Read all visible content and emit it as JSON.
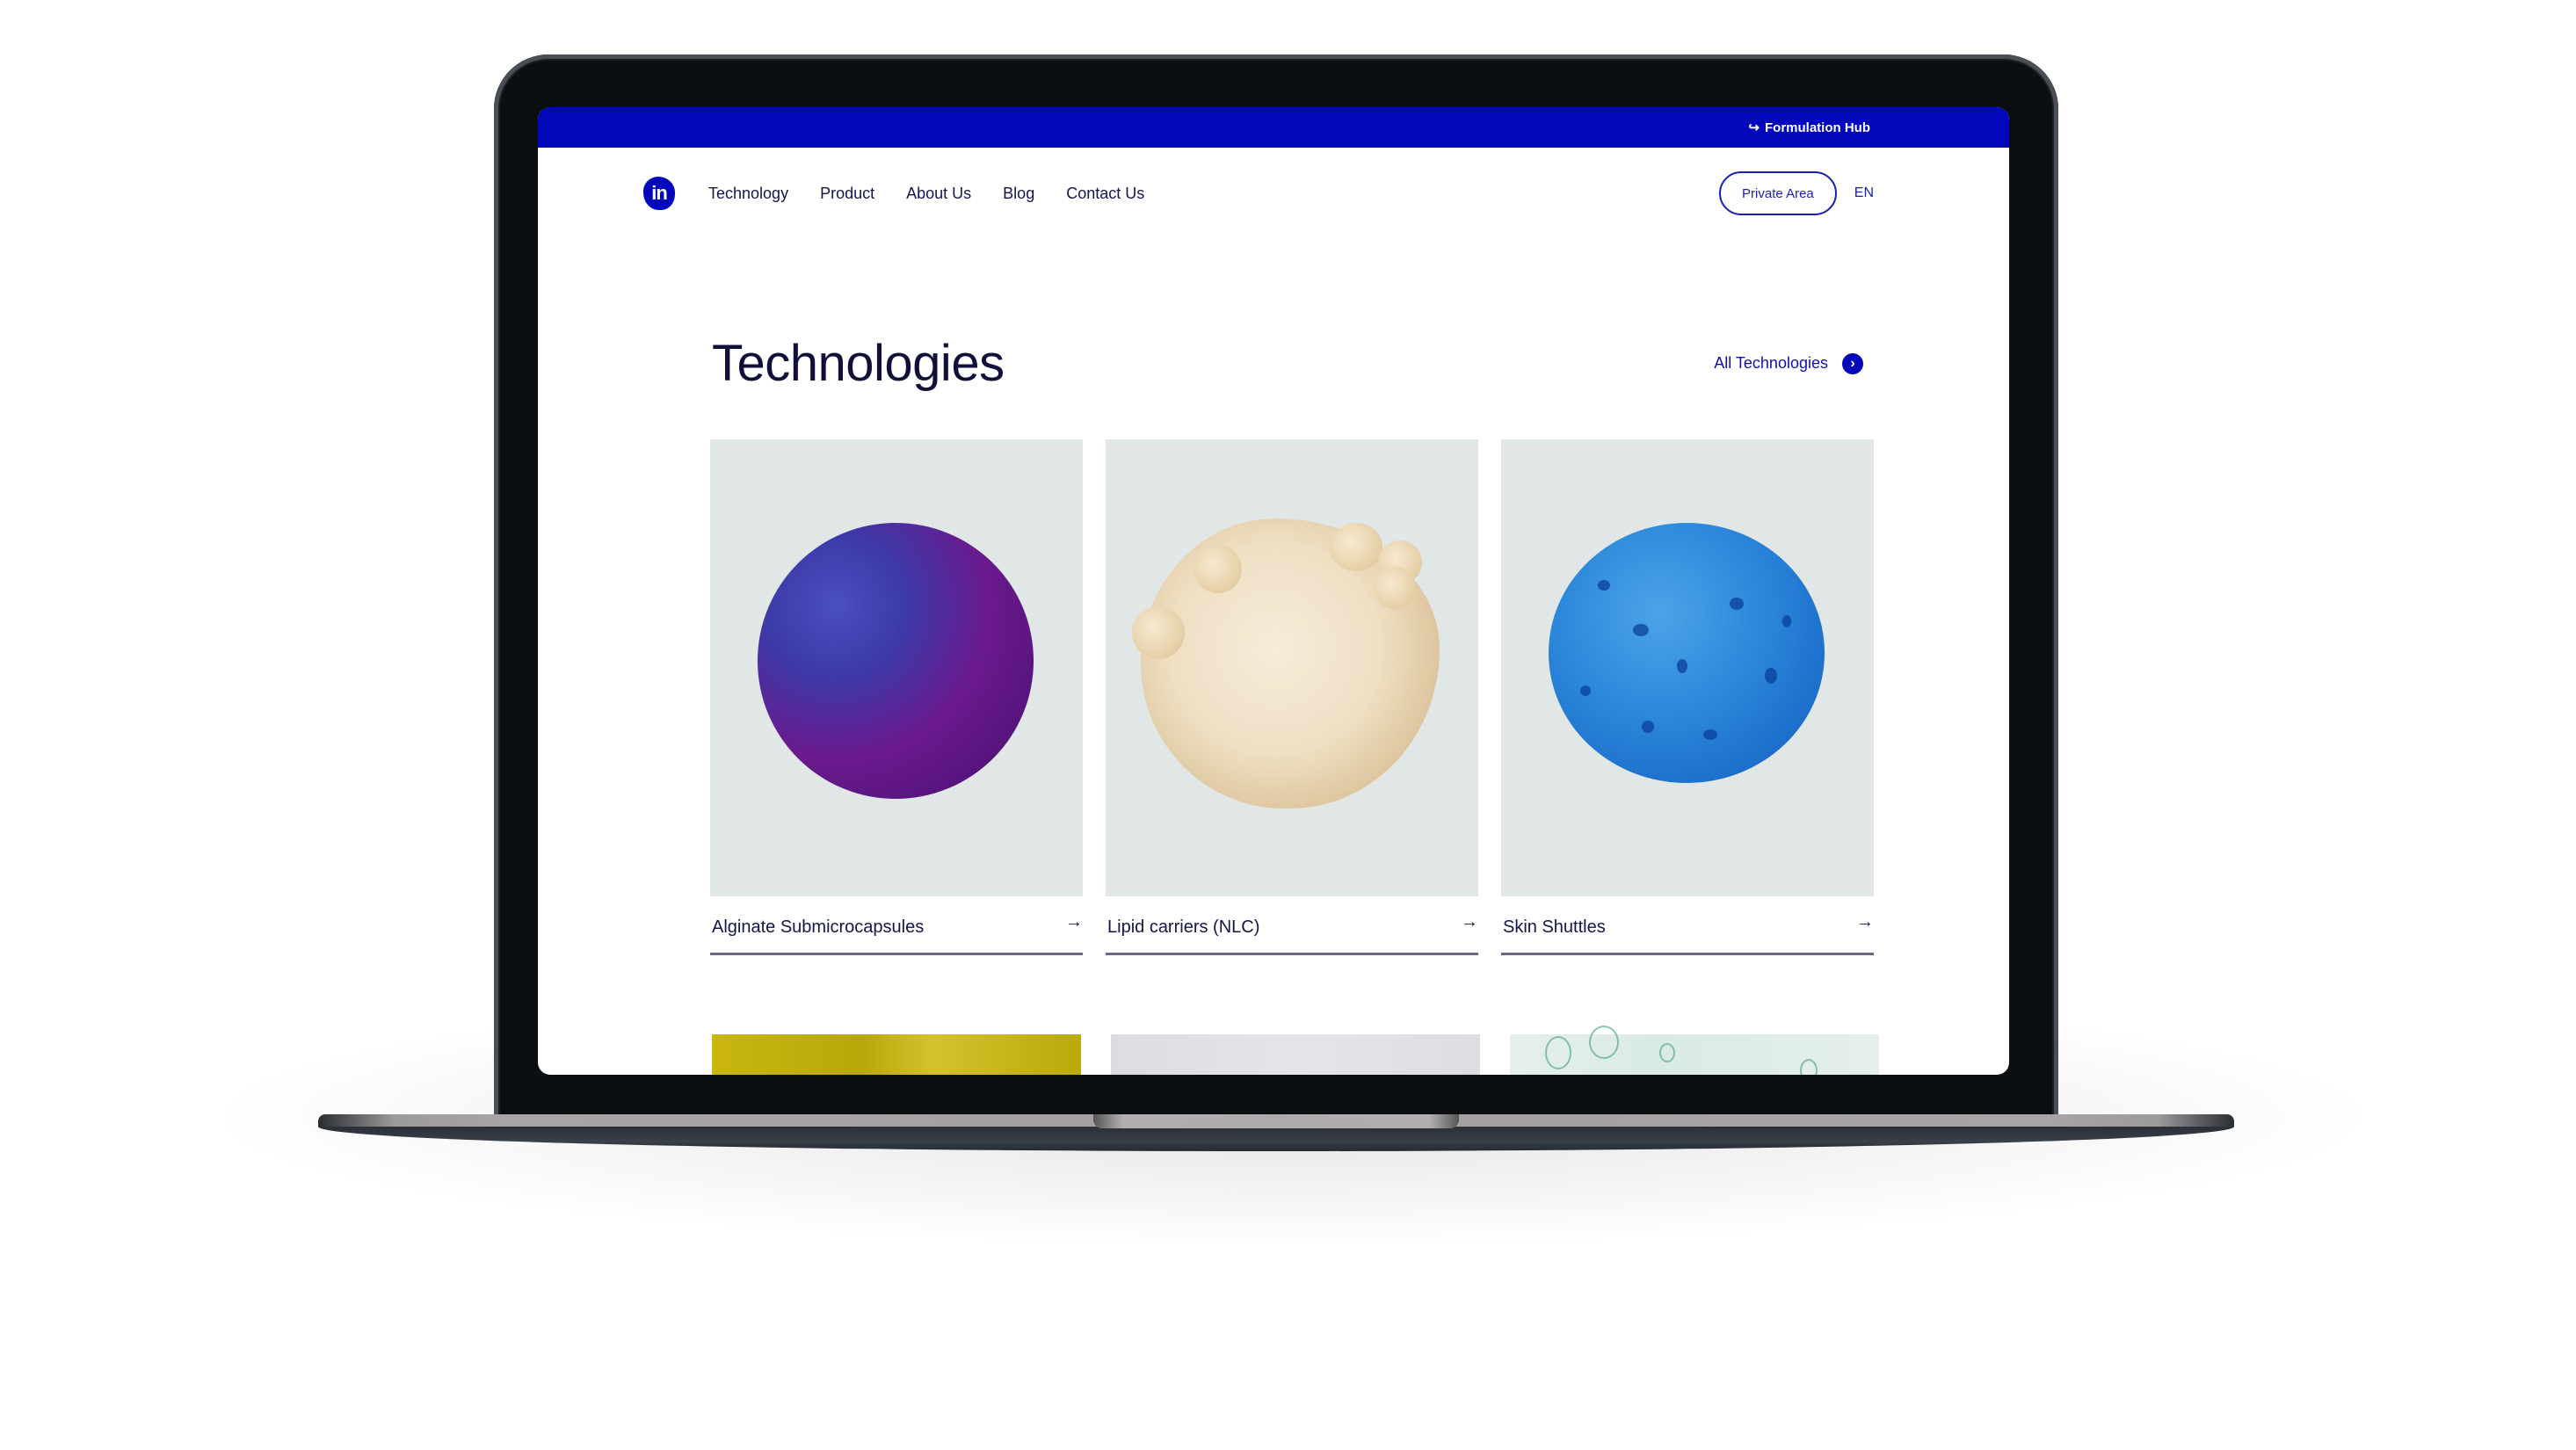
{
  "topbar": {
    "hub_icon": "arrow-hook-right-icon",
    "hub_label": "Formulation Hub"
  },
  "nav": {
    "logo_text": "in",
    "links": [
      "Technology",
      "Product",
      "About Us",
      "Blog",
      "Contact Us"
    ],
    "private_area_label": "Private Area",
    "language": "EN"
  },
  "section": {
    "title": "Technologies",
    "all_link_label": "All Technologies",
    "all_link_icon": "chevron-right-circle-icon"
  },
  "cards": [
    {
      "title": "Alginate Submicrocapsules",
      "arrow": "→",
      "image": "purple-textured-sphere"
    },
    {
      "title": "Lipid carriers (NLC)",
      "arrow": "→",
      "image": "cream-lumpy-particle"
    },
    {
      "title": "Skin Shuttles",
      "arrow": "→",
      "image": "blue-porous-sphere"
    }
  ],
  "next_row_images": [
    "yellow-oil-bubbles",
    "grey-water-droplets",
    "green-bubbles"
  ],
  "colors": {
    "brand_blue": "#0207bb",
    "text_dark": "#15154a",
    "card_bg": "#e1e7e7"
  }
}
